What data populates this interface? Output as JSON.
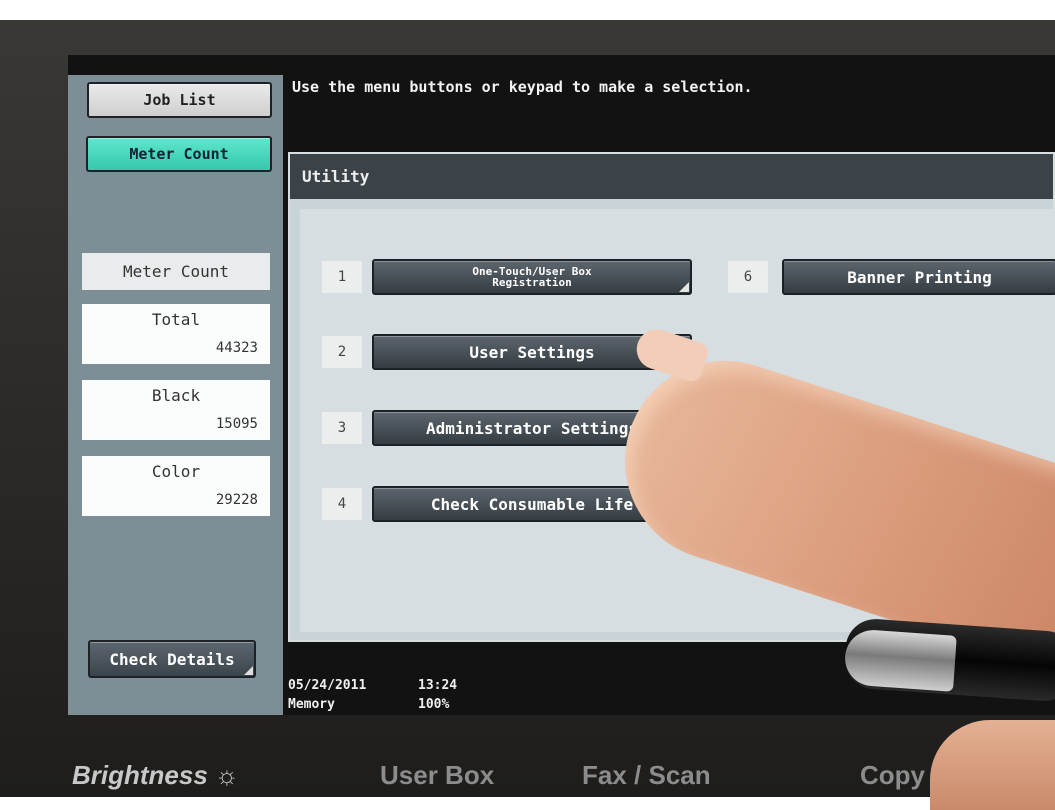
{
  "left": {
    "job_list": "Job List",
    "meter_count_tab": "Meter Count",
    "meter_count_title": "Meter Count",
    "total_label": "Total",
    "total_value": "44323",
    "black_label": "Black",
    "black_value": "15095",
    "color_label": "Color",
    "color_value": "29228",
    "check_details": "Check Details"
  },
  "message": "Use the menu buttons or keypad to make a selection.",
  "utility": {
    "title": "Utility",
    "items": [
      {
        "num": "1",
        "label": "One-Touch/User Box Registration"
      },
      {
        "num": "2",
        "label": "User Settings"
      },
      {
        "num": "3",
        "label": "Administrator Settings"
      },
      {
        "num": "4",
        "label": "Check Consumable Life"
      },
      {
        "num": "6",
        "label": "Banner Printing"
      }
    ]
  },
  "status": {
    "date": "05/24/2011",
    "time": "13:24",
    "memory_label": "Memory",
    "memory_value": "100%"
  },
  "hardware": {
    "brightness": "Brightness ☼",
    "user_box": "User Box",
    "fax_scan": "Fax / Scan",
    "copy": "Copy"
  },
  "colors": {
    "active_tab": "#35c9ad",
    "panel": "#7e8e97",
    "button": "#3a444b"
  }
}
